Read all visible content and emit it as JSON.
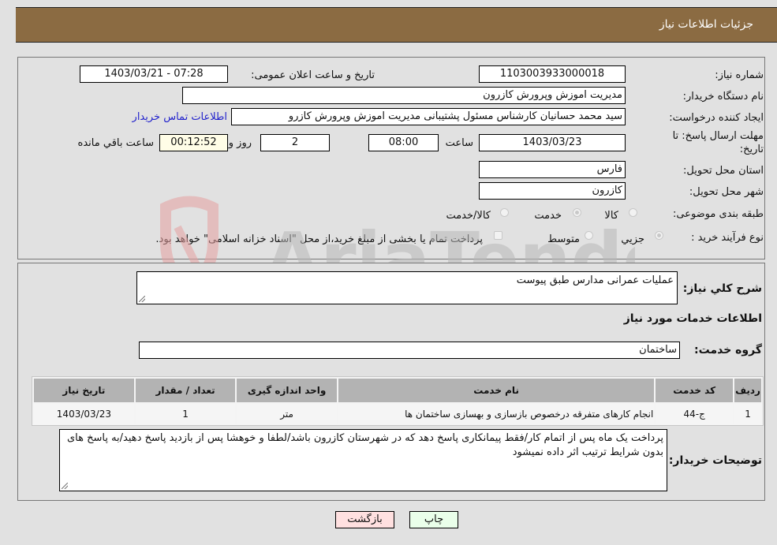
{
  "header": {
    "title": "جزئیات اطلاعات نیاز"
  },
  "details": {
    "need_number_label": "شماره نیاز:",
    "need_number": "1103003933000018",
    "announce_label": "تاریخ و ساعت اعلان عمومی:",
    "announce_value": "1403/03/21 - 07:28",
    "buyer_org_label": "نام دستگاه خریدار:",
    "buyer_org": "مدیریت اموزش وپرورش کازرون",
    "creator_label": "ایجاد کننده درخواست:",
    "creator": "سید محمد  حسانیان  کارشناس مسئول پشتیبانی مدیریت اموزش وپرورش کازرو",
    "contact_link": "اطلاعات تماس خریدار",
    "deadline_label_1": "مهلت ارسال پاسخ: تا",
    "deadline_label_2": "تاریخ:",
    "deadline_date": "1403/03/23",
    "time_label": "ساعت",
    "deadline_time": "08:00",
    "days_value": "2",
    "days_label": "روز و",
    "remaining_time": "00:12:52",
    "remaining_label": "ساعت باقي مانده",
    "province_label": "استان محل تحویل:",
    "province": "فارس",
    "city_label": "شهر محل تحویل:",
    "city": "کازرون",
    "category_label": "طبقه بندی موضوعی:",
    "category_options": [
      {
        "label": "کالا",
        "checked": false
      },
      {
        "label": "خدمت",
        "checked": true
      },
      {
        "label": "کالا/خدمت",
        "checked": false
      }
    ],
    "process_label": "نوع فرآیند خرید :",
    "process_options": [
      {
        "label": "جزيي",
        "checked": true
      },
      {
        "label": "متوسط",
        "checked": false
      }
    ],
    "payment_note": "پرداخت تمام یا بخشی از مبلغ خرید،از محل \"اسناد خزانه اسلامی\" خواهد بود."
  },
  "summary": {
    "description_label": "شرح کلي نياز:",
    "description": "عملیات عمرانی مدارس طبق پیوست",
    "services_title": "اطلاعات خدمات مورد نياز",
    "service_group_label": "گروه خدمت:",
    "service_group": "ساختمان"
  },
  "table": {
    "headers": [
      "رديف",
      "کد خدمت",
      "نام خدمت",
      "واحد اندازه گیری",
      "تعداد / مقدار",
      "تاریخ نیاز"
    ],
    "rows": [
      [
        "1",
        "ج-44",
        "انجام کارهای متفرقه درخصوص بازسازی و بهسازی ساختمان ها",
        "متر",
        "1",
        "1403/03/23"
      ]
    ]
  },
  "buyer_notes": {
    "label": "توضیحات خریدار:",
    "text": "پرداخت یک ماه پس از اتمام کار/فقط پیمانکاری پاسخ دهد که در شهرستان کازرون باشد/لطفا و خوهشا پس از بازدید پاسخ دهید/به پاسخ های بدون شرایط ترتیب اثر داده نمیشود"
  },
  "buttons": {
    "print": "چاپ",
    "back": "بازگشت"
  },
  "colors": {
    "header_bg": "#8b6b42",
    "back_button_bg": "#ffe0e0",
    "print_button_bg": "#eaffea",
    "link": "#2222cc"
  },
  "watermark": {
    "text": "AriaTender.neT"
  }
}
